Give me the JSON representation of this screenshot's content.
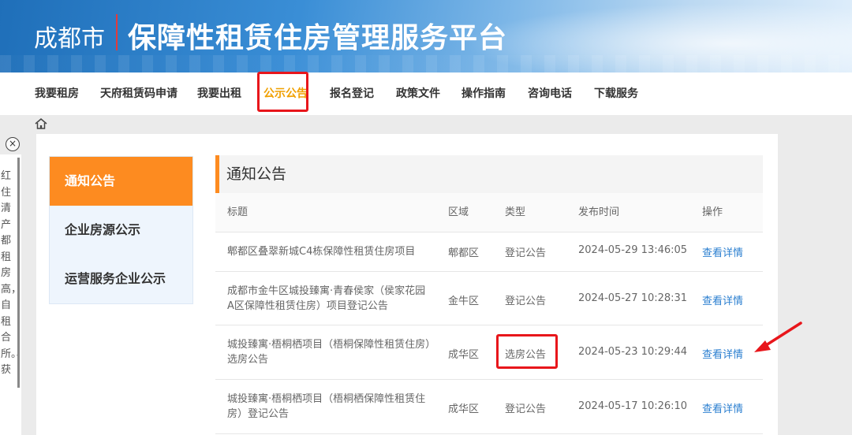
{
  "header": {
    "city": "成都市",
    "platform_title": "保障性租赁住房管理服务平台"
  },
  "nav": {
    "items": [
      {
        "label": "我要租房"
      },
      {
        "label": "天府租赁码申请"
      },
      {
        "label": "我要出租"
      },
      {
        "label": "公示公告",
        "active": true
      },
      {
        "label": "报名登记"
      },
      {
        "label": "政策文件"
      },
      {
        "label": "操作指南"
      },
      {
        "label": "咨询电话"
      },
      {
        "label": "下载服务"
      }
    ]
  },
  "side_ad": {
    "close_glyph": "×",
    "text": "红住清产都租房高，自 租合所。、获"
  },
  "left_menu": {
    "items": [
      {
        "label": "通知公告",
        "active": true
      },
      {
        "label": "企业房源公示"
      },
      {
        "label": "运营服务企业公示"
      }
    ]
  },
  "panel": {
    "title": "通知公告",
    "columns": {
      "title": "标题",
      "area": "区域",
      "type": "类型",
      "date": "发布时间",
      "op": "操作"
    },
    "rows": [
      {
        "title": "郫都区叠翠新城C4栋保障性租赁住房项目",
        "area": "郫都区",
        "type": "登记公告",
        "date": "2024-05-29 13:46:05",
        "op": "查看详情"
      },
      {
        "title": "成都市金牛区城投臻寓·青春侯家（侯家花园A区保障性租赁住房）项目登记公告",
        "area": "金牛区",
        "type": "登记公告",
        "date": "2024-05-27 10:28:31",
        "op": "查看详情"
      },
      {
        "title": "城投臻寓·梧桐栖项目（梧桐保障性租赁住房）选房公告",
        "area": "成华区",
        "type": "选房公告",
        "date": "2024-05-23 10:29:44",
        "op": "查看详情"
      },
      {
        "title": "城投臻寓·梧桐栖项目（梧桐栖保障性租赁住房）登记公告",
        "area": "成华区",
        "type": "登记公告",
        "date": "2024-05-17 10:26:10",
        "op": "查看详情"
      }
    ]
  },
  "colors": {
    "accent_orange": "#fd8b20",
    "nav_active": "#f0a000",
    "highlight_red": "#e8161b",
    "link_blue": "#2b7fd0"
  },
  "icons": {
    "home": "home-icon",
    "close": "close-circle-icon",
    "annotation": "red-arrow-icon"
  }
}
